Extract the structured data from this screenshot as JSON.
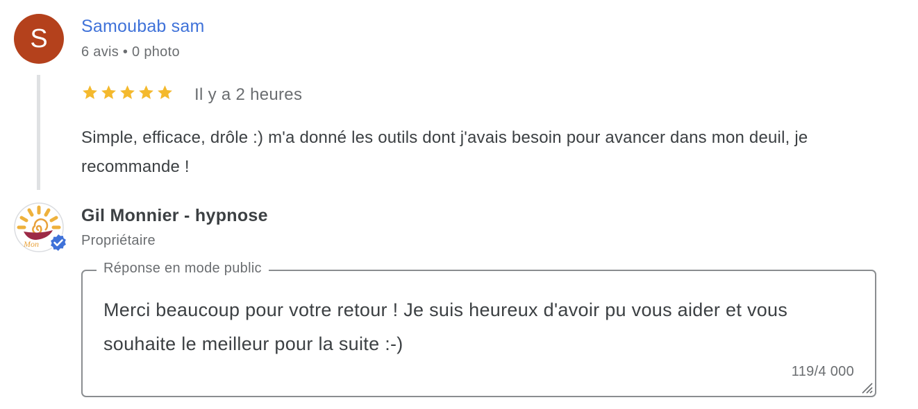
{
  "review": {
    "author_initial": "S",
    "author_name": "Samoubab sam",
    "author_meta": "6 avis • 0 photo",
    "rating": 5,
    "max_rating": 5,
    "time": "Il y a 2 heures",
    "text": "Simple, efficace, drôle :) m'a donné les outils dont j'avais besoin pour avancer dans mon deuil, je recommande !",
    "avatar_color": "#b4411c",
    "name_color": "#3f72d9",
    "star_color": "#f4b92d"
  },
  "owner": {
    "name": "Gil Monnier - hypnose",
    "role": "Propriétaire",
    "logo_text": "Mon",
    "verified_icon": "verified-badge-icon",
    "verified_color": "#3f72d9"
  },
  "reply": {
    "label": "Réponse en mode public",
    "text": "Merci beaucoup pour votre retour ! Je suis heureux d'avoir pu vous aider et vous souhaite le meilleur pour la suite :-)",
    "char_count": "119/4 000"
  }
}
